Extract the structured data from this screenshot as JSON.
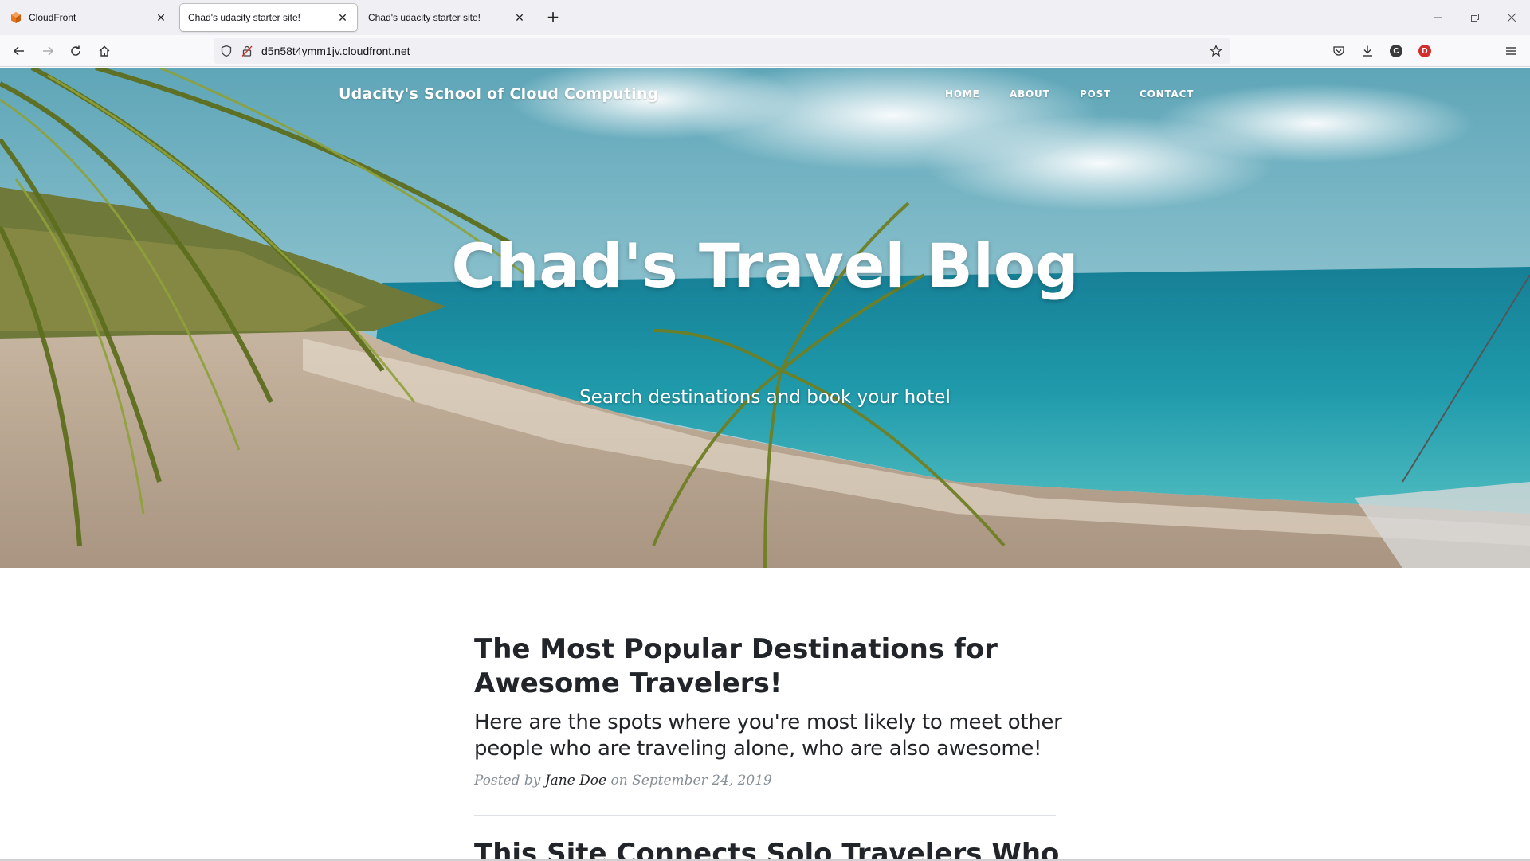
{
  "browser": {
    "tabs": [
      {
        "title": "CloudFront",
        "favicon": "aws-cube-icon",
        "active": false
      },
      {
        "title": "Chad's udacity starter site!",
        "favicon": "",
        "active": true
      },
      {
        "title": "Chad's udacity starter site!",
        "favicon": "",
        "active": false
      }
    ],
    "url": "d5n58t4ymm1jv.cloudfront.net",
    "profile_c": "C",
    "profile_d": "D"
  },
  "site": {
    "brand": "Udacity's School of Cloud Computing",
    "nav": [
      "HOME",
      "ABOUT",
      "POST",
      "CONTACT"
    ],
    "hero_title": "Chad's Travel Blog",
    "hero_subtitle": "Search destinations and book your hotel"
  },
  "posts": [
    {
      "title": "The Most Popular Destinations for Awesome Travelers!",
      "subtitle": "Here are the spots where you're most likely to meet other people who are traveling alone, who are also awesome!",
      "meta_prefix": "Posted by",
      "author": "Jane Doe",
      "meta_on": "on",
      "date": "September 24, 2019"
    },
    {
      "title": "This Site Connects Solo Travelers Who"
    }
  ],
  "colors": {
    "accent_cloudfront": "#e8761c",
    "text_dark": "#212529",
    "meta_gray": "#868e96"
  }
}
